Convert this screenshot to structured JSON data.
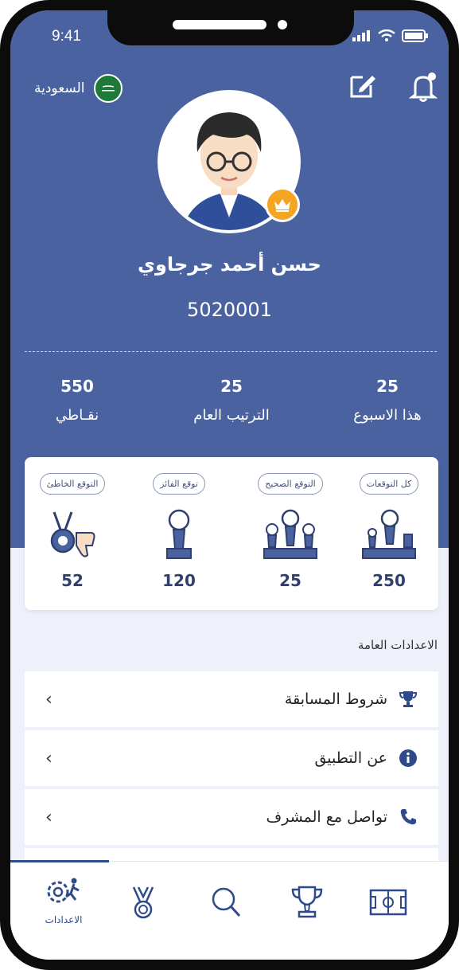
{
  "status": {
    "time": "9:41"
  },
  "header": {
    "country_label": "السعودية"
  },
  "profile": {
    "name": "حسن أحمد جرجاوي",
    "id": "5020001"
  },
  "stats": [
    {
      "value": "25",
      "label": "هذا الاسبوع"
    },
    {
      "value": "25",
      "label": "الترتيب العام"
    },
    {
      "value": "550",
      "label": "نقـاطي"
    }
  ],
  "predictions": [
    {
      "label": "كل التوقعات",
      "value": "250",
      "icon": "trophies-group-icon"
    },
    {
      "label": "التوقع الصحيح",
      "value": "25",
      "icon": "triple-trophy-icon"
    },
    {
      "label": "توقع الفائز",
      "value": "120",
      "icon": "single-trophy-icon"
    },
    {
      "label": "التوقع الخاطئ",
      "value": "52",
      "icon": "medal-thumbs-down-icon"
    }
  ],
  "settings": {
    "title": "الاعدادات العامة",
    "items": [
      {
        "label": "شروط المسابقة",
        "icon": "trophy-icon"
      },
      {
        "label": "عن التطبيق",
        "icon": "info-icon"
      },
      {
        "label": "تواصل مع المشرف",
        "icon": "phone-icon"
      }
    ]
  },
  "tabbar": {
    "active_label": "الاعدادات",
    "items": [
      "settings-icon",
      "medal-icon",
      "search-icon",
      "trophy-icon",
      "field-icon"
    ]
  },
  "colors": {
    "primary": "#4a62a0",
    "accent": "#f4a623",
    "navy": "#2f4a8a"
  }
}
